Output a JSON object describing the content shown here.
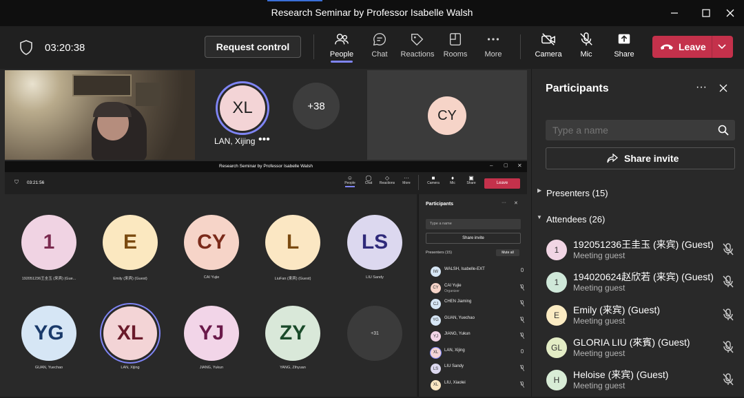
{
  "window": {
    "title": "Research Seminar by Professor Isabelle Walsh"
  },
  "toolbar": {
    "timer": "03:20:38",
    "request_control": "Request control",
    "people": "People",
    "chat": "Chat",
    "reactions": "Reactions",
    "rooms": "Rooms",
    "more": "More",
    "camera": "Camera",
    "mic": "Mic",
    "share": "Share",
    "leave": "Leave"
  },
  "stage": {
    "xl_name": "LAN, Xijing",
    "xl_initials": "XL",
    "overflow": "+38",
    "cy_initials": "CY"
  },
  "panel": {
    "title": "Participants",
    "search_placeholder": "Type a name",
    "share_invite": "Share invite",
    "presenters": "Presenters (15)",
    "attendees": "Attendees (26)",
    "rows": [
      {
        "initials": "1",
        "name": "192051236王圭玉 (来宾) (Guest)",
        "sub": "Meeting guest",
        "color": "#f1d5e4"
      },
      {
        "initials": "1",
        "name": "194020624赵欣若 (来宾) (Guest)",
        "sub": "Meeting guest",
        "color": "#cfe8d9"
      },
      {
        "initials": "E",
        "name": "Emily (来宾) (Guest)",
        "sub": "Meeting guest",
        "color": "#fbebc2"
      },
      {
        "initials": "GL",
        "name": "GLORIA LIU (來賓) (Guest)",
        "sub": "Meeting guest",
        "color": "#e3ecc5"
      },
      {
        "initials": "H",
        "name": "Heloise (来宾) (Guest)",
        "sub": "Meeting guest",
        "color": "#d8ecd6"
      }
    ]
  },
  "share": {
    "title": "Research Seminar by Professor Isabelle Walsh",
    "timer": "03:21:56",
    "people": "People",
    "chat": "Chat",
    "reactions": "Reactions",
    "more": "More",
    "camera": "Camera",
    "mic": "Mic",
    "share": "Share",
    "leave": "Leave",
    "tiles": [
      {
        "initials": "1",
        "name": "192051236王圭玉 (来宾) (Gue...",
        "bg": "#f0d3e3",
        "fg": "#7a2a4f"
      },
      {
        "initials": "E",
        "name": "Emily (来宾) (Guest)",
        "bg": "#fbe8c0",
        "fg": "#7a4a10"
      },
      {
        "initials": "CY",
        "name": "CAI Yujie",
        "bg": "#f6d4c8",
        "fg": "#7a2a1a"
      },
      {
        "initials": "L",
        "name": "LiuFan (来宾) (Guest)",
        "bg": "#fbe7c3",
        "fg": "#7a4a10"
      },
      {
        "initials": "LS",
        "name": "LIU Sandy",
        "bg": "#dcd8ef",
        "fg": "#2f2a7a"
      },
      {
        "initials": "YG",
        "name": "GUAN, Yuechao",
        "bg": "#d6e6f5",
        "fg": "#1a3a6a"
      },
      {
        "initials": "XL",
        "name": "LAN, Xijing",
        "bg": "#f3d4d6",
        "fg": "#6a1a2a"
      },
      {
        "initials": "YJ",
        "name": "JIANG, Yukun",
        "bg": "#f2d5e8",
        "fg": "#6a1a4a"
      },
      {
        "initials": "ZY",
        "name": "YANG, Zihyuan",
        "bg": "#d9e8d9",
        "fg": "#1a4a2a"
      },
      {
        "initials": "+31",
        "name": "",
        "bg": "#3b3b3b",
        "fg": "#dddddd"
      }
    ],
    "panel_title": "Participants",
    "search": "Type a name",
    "share_invite": "Share invite",
    "presenters": "Presenters (15)",
    "mute_all": "Mute all",
    "list": [
      {
        "initials": "IW",
        "name": "WALSH, Isabelle-EXT",
        "sub": "",
        "color": "#d6e6f5"
      },
      {
        "initials": "CY",
        "name": "CAI Yujie",
        "sub": "Organizer",
        "color": "#f6d4c8"
      },
      {
        "initials": "CJ",
        "name": "CHEN Jiaming",
        "sub": "",
        "color": "#d6e6f5"
      },
      {
        "initials": "YG",
        "name": "GUAN, Yuechao",
        "sub": "",
        "color": "#d6e6f5"
      },
      {
        "initials": "YJ",
        "name": "JIANG, Yukun",
        "sub": "",
        "color": "#f2d5e8"
      },
      {
        "initials": "XL",
        "name": "LAN, Xijing",
        "sub": "",
        "color": "#f3d4d6"
      },
      {
        "initials": "LS",
        "name": "LIU Sandy",
        "sub": "",
        "color": "#dcd8ef"
      },
      {
        "initials": "XL",
        "name": "LIU, Xiaolei",
        "sub": "",
        "color": "#fbe7c3"
      }
    ]
  },
  "colors": {
    "accent": "#7f85f5",
    "leave": "#c4314b"
  }
}
